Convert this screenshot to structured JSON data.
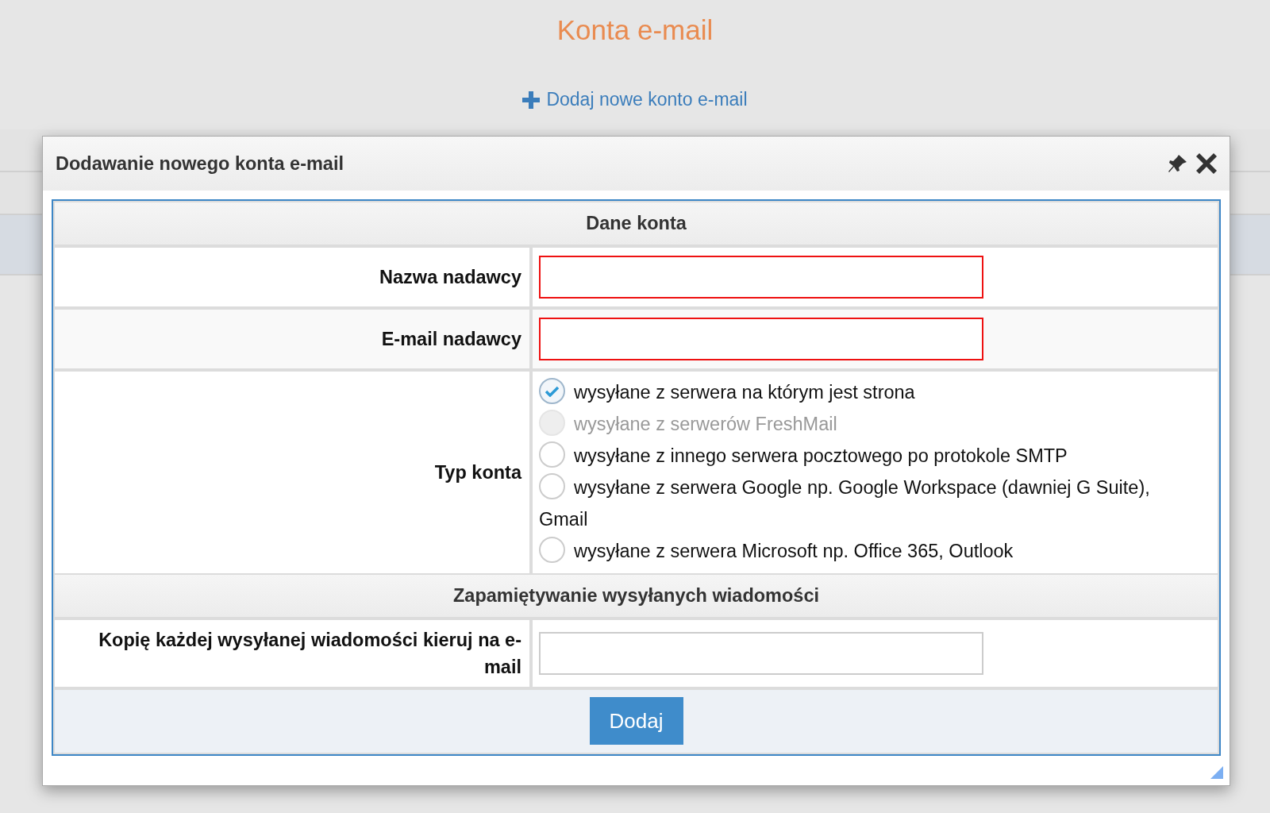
{
  "page": {
    "title": "Konta e-mail",
    "add_link": "Dodaj nowe konto e-mail"
  },
  "dialog": {
    "title": "Dodawanie nowego konta e-mail",
    "sections": [
      {
        "heading": "Dane konta",
        "fields": [
          {
            "kind": "text",
            "label": "Nazwa nadawcy",
            "invalid": true
          },
          {
            "kind": "text",
            "label": "E-mail nadawcy",
            "invalid": true
          },
          {
            "kind": "radio",
            "label": "Typ konta",
            "options": [
              {
                "label": "wysyłane z serwera na którym jest strona",
                "selected": true,
                "disabled": false
              },
              {
                "label": "wysyłane z serwerów FreshMail",
                "selected": false,
                "disabled": true
              },
              {
                "label": "wysyłane z innego serwera pocztowego po protokole SMTP",
                "selected": false,
                "disabled": false
              },
              {
                "label": "wysyłane z serwera Google np. Google Workspace (dawniej G Suite), Gmail",
                "selected": false,
                "disabled": false
              },
              {
                "label": "wysyłane z serwera Microsoft np. Office 365, Outlook",
                "selected": false,
                "disabled": false
              }
            ]
          }
        ]
      },
      {
        "heading": "Zapamiętywanie wysyłanych wiadomości",
        "fields": [
          {
            "kind": "text",
            "label": "Kopię każdej wysyłanej wiadomości kieruj na e-mail",
            "invalid": false
          }
        ]
      }
    ],
    "submit": "Dodaj"
  }
}
